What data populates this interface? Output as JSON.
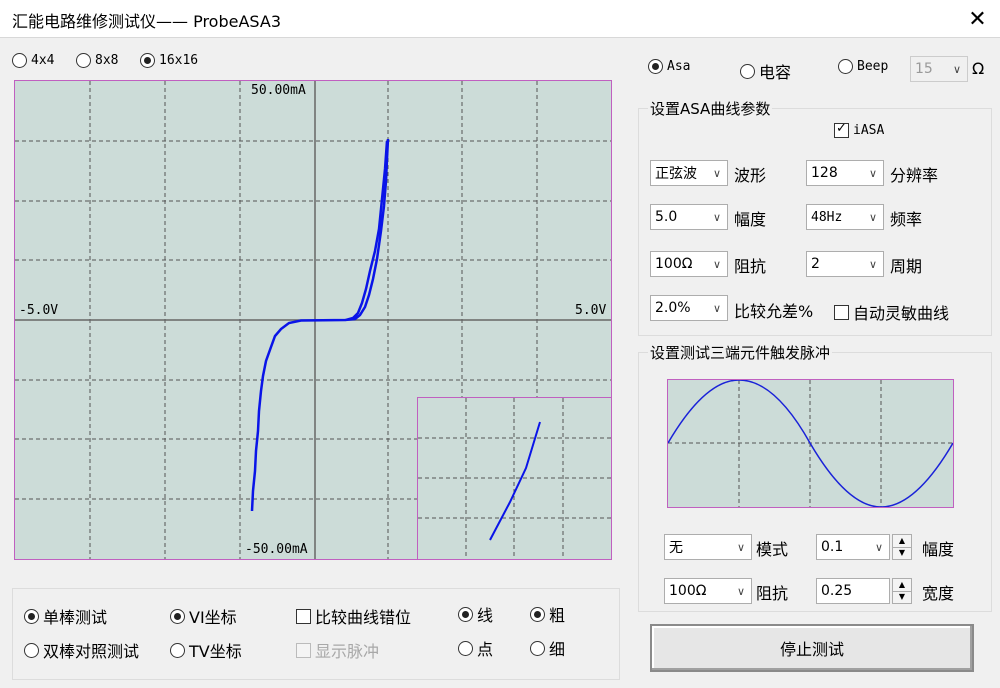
{
  "window": {
    "title": "汇能电路维修测试仪—— ProbeASA3",
    "close_glyph": "✕"
  },
  "grid_options": {
    "items": [
      "4x4",
      "8x8",
      "16x16"
    ],
    "selected": "16x16"
  },
  "mode_options": {
    "asa": "Asa",
    "capacitance": "电容",
    "beep": "Beep",
    "selected": "Asa",
    "beep_threshold": "15",
    "beep_unit": "Ω"
  },
  "main_plot": {
    "y_max": "50.00mA",
    "y_min": "-50.00mA",
    "x_min": "-5.0V",
    "x_max": "5.0V",
    "trace_color": "#0a14e8"
  },
  "asa_params": {
    "title": "设置ASA曲线参数",
    "iasa_label": "iASA",
    "waveform_value": "正弦波",
    "waveform_label": "波形",
    "resolution_value": "128",
    "resolution_label": "分辨率",
    "amplitude_value": "5.0",
    "amplitude_label": "幅度",
    "frequency_value": "48Hz",
    "frequency_label": "频率",
    "impedance_value": "100Ω",
    "impedance_label": "阻抗",
    "period_value": "2",
    "period_label": "周期",
    "tolerance_value": "2.0%",
    "tolerance_label": "比较允差%",
    "auto_sens_label": "自动灵敏曲线"
  },
  "pulse_params": {
    "title": "设置测试三端元件触发脉冲",
    "mode_value": "无",
    "mode_label": "模式",
    "amp_value": "0.1",
    "amp_label": "幅度",
    "imp_value": "100Ω",
    "imp_label": "阻抗",
    "width_value": "0.25",
    "width_label": "宽度"
  },
  "bottom_options": {
    "single_probe": "单棒测试",
    "dual_probe": "双棒对照测试",
    "vi_axis": "VI坐标",
    "tv_axis": "TV坐标",
    "compare_offset": "比较曲线错位",
    "show_pulse": "显示脉冲",
    "line": "线",
    "dot": "点",
    "thick": "粗",
    "thin": "细"
  },
  "stop_button": "停止测试"
}
